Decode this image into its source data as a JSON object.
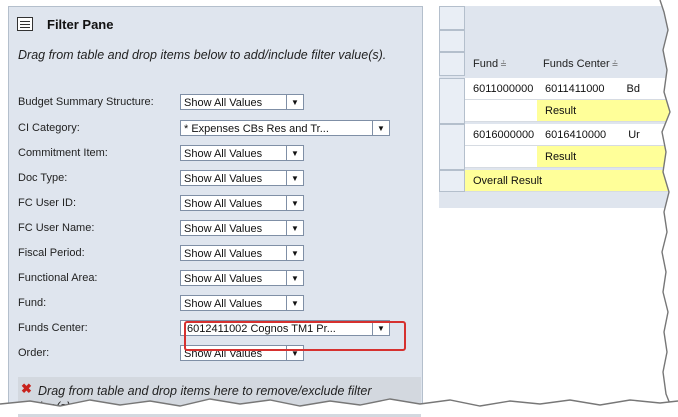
{
  "filter_pane": {
    "title": "Filter Pane",
    "instruction": "Drag from table and drop items below to add/include filter value(s).",
    "filters": [
      {
        "label": "Budget Summary Structure:",
        "value": "Show All Values"
      },
      {
        "label": "CI Category:",
        "value": "* Expenses CBs Res and Tr..."
      },
      {
        "label": "Commitment Item:",
        "value": "Show All Values"
      },
      {
        "label": "Doc Type:",
        "value": "Show All Values"
      },
      {
        "label": "FC User ID:",
        "value": "Show All Values"
      },
      {
        "label": "FC User Name:",
        "value": "Show All Values"
      },
      {
        "label": "Fiscal Period:",
        "value": "Show All Values"
      },
      {
        "label": "Functional Area:",
        "value": "Show All Values"
      },
      {
        "label": "Fund:",
        "value": "Show All Values"
      },
      {
        "label": "Funds Center:",
        "value": "!6012411002 Cognos TM1 Pr..."
      },
      {
        "label": "Order:",
        "value": "Show All Values"
      }
    ],
    "remove_instruction": "Drag from table and drop items here to remove/exclude filter value(s)."
  },
  "table": {
    "columns": [
      "Fund",
      "Funds Center"
    ],
    "partial_cells": [
      "Bd",
      "Ur"
    ],
    "rows": [
      {
        "fund": "6011000000",
        "funds_center": "6011411000"
      },
      {
        "result": "Result"
      },
      {
        "fund": "6016000000",
        "funds_center": "6016410000"
      },
      {
        "result": "Result"
      },
      {
        "overall": "Overall Result"
      }
    ]
  },
  "colors": {
    "highlight": "#d6312f",
    "result_row": "#ffff99",
    "pane_bg": "#dfe5ee"
  }
}
